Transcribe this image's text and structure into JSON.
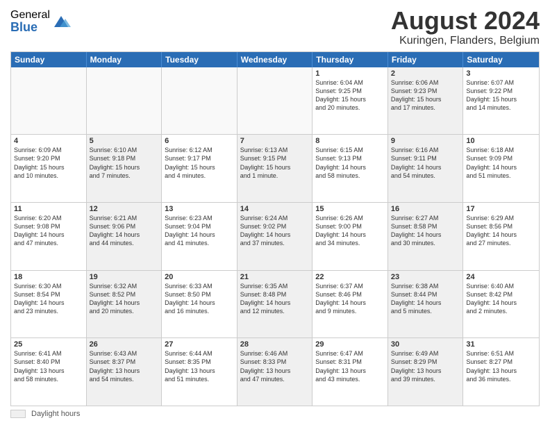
{
  "logo": {
    "general": "General",
    "blue": "Blue"
  },
  "title": "August 2024",
  "subtitle": "Kuringen, Flanders, Belgium",
  "days": [
    "Sunday",
    "Monday",
    "Tuesday",
    "Wednesday",
    "Thursday",
    "Friday",
    "Saturday"
  ],
  "rows": [
    [
      {
        "num": "",
        "info": "",
        "empty": true
      },
      {
        "num": "",
        "info": "",
        "empty": true
      },
      {
        "num": "",
        "info": "",
        "empty": true
      },
      {
        "num": "",
        "info": "",
        "empty": true
      },
      {
        "num": "1",
        "info": "Sunrise: 6:04 AM\nSunset: 9:25 PM\nDaylight: 15 hours\nand 20 minutes."
      },
      {
        "num": "2",
        "info": "Sunrise: 6:06 AM\nSunset: 9:23 PM\nDaylight: 15 hours\nand 17 minutes.",
        "shaded": true
      },
      {
        "num": "3",
        "info": "Sunrise: 6:07 AM\nSunset: 9:22 PM\nDaylight: 15 hours\nand 14 minutes."
      }
    ],
    [
      {
        "num": "4",
        "info": "Sunrise: 6:09 AM\nSunset: 9:20 PM\nDaylight: 15 hours\nand 10 minutes."
      },
      {
        "num": "5",
        "info": "Sunrise: 6:10 AM\nSunset: 9:18 PM\nDaylight: 15 hours\nand 7 minutes.",
        "shaded": true
      },
      {
        "num": "6",
        "info": "Sunrise: 6:12 AM\nSunset: 9:17 PM\nDaylight: 15 hours\nand 4 minutes."
      },
      {
        "num": "7",
        "info": "Sunrise: 6:13 AM\nSunset: 9:15 PM\nDaylight: 15 hours\nand 1 minute.",
        "shaded": true
      },
      {
        "num": "8",
        "info": "Sunrise: 6:15 AM\nSunset: 9:13 PM\nDaylight: 14 hours\nand 58 minutes."
      },
      {
        "num": "9",
        "info": "Sunrise: 6:16 AM\nSunset: 9:11 PM\nDaylight: 14 hours\nand 54 minutes.",
        "shaded": true
      },
      {
        "num": "10",
        "info": "Sunrise: 6:18 AM\nSunset: 9:09 PM\nDaylight: 14 hours\nand 51 minutes."
      }
    ],
    [
      {
        "num": "11",
        "info": "Sunrise: 6:20 AM\nSunset: 9:08 PM\nDaylight: 14 hours\nand 47 minutes."
      },
      {
        "num": "12",
        "info": "Sunrise: 6:21 AM\nSunset: 9:06 PM\nDaylight: 14 hours\nand 44 minutes.",
        "shaded": true
      },
      {
        "num": "13",
        "info": "Sunrise: 6:23 AM\nSunset: 9:04 PM\nDaylight: 14 hours\nand 41 minutes."
      },
      {
        "num": "14",
        "info": "Sunrise: 6:24 AM\nSunset: 9:02 PM\nDaylight: 14 hours\nand 37 minutes.",
        "shaded": true
      },
      {
        "num": "15",
        "info": "Sunrise: 6:26 AM\nSunset: 9:00 PM\nDaylight: 14 hours\nand 34 minutes."
      },
      {
        "num": "16",
        "info": "Sunrise: 6:27 AM\nSunset: 8:58 PM\nDaylight: 14 hours\nand 30 minutes.",
        "shaded": true
      },
      {
        "num": "17",
        "info": "Sunrise: 6:29 AM\nSunset: 8:56 PM\nDaylight: 14 hours\nand 27 minutes."
      }
    ],
    [
      {
        "num": "18",
        "info": "Sunrise: 6:30 AM\nSunset: 8:54 PM\nDaylight: 14 hours\nand 23 minutes."
      },
      {
        "num": "19",
        "info": "Sunrise: 6:32 AM\nSunset: 8:52 PM\nDaylight: 14 hours\nand 20 minutes.",
        "shaded": true
      },
      {
        "num": "20",
        "info": "Sunrise: 6:33 AM\nSunset: 8:50 PM\nDaylight: 14 hours\nand 16 minutes."
      },
      {
        "num": "21",
        "info": "Sunrise: 6:35 AM\nSunset: 8:48 PM\nDaylight: 14 hours\nand 12 minutes.",
        "shaded": true
      },
      {
        "num": "22",
        "info": "Sunrise: 6:37 AM\nSunset: 8:46 PM\nDaylight: 14 hours\nand 9 minutes."
      },
      {
        "num": "23",
        "info": "Sunrise: 6:38 AM\nSunset: 8:44 PM\nDaylight: 14 hours\nand 5 minutes.",
        "shaded": true
      },
      {
        "num": "24",
        "info": "Sunrise: 6:40 AM\nSunset: 8:42 PM\nDaylight: 14 hours\nand 2 minutes."
      }
    ],
    [
      {
        "num": "25",
        "info": "Sunrise: 6:41 AM\nSunset: 8:40 PM\nDaylight: 13 hours\nand 58 minutes."
      },
      {
        "num": "26",
        "info": "Sunrise: 6:43 AM\nSunset: 8:37 PM\nDaylight: 13 hours\nand 54 minutes.",
        "shaded": true
      },
      {
        "num": "27",
        "info": "Sunrise: 6:44 AM\nSunset: 8:35 PM\nDaylight: 13 hours\nand 51 minutes."
      },
      {
        "num": "28",
        "info": "Sunrise: 6:46 AM\nSunset: 8:33 PM\nDaylight: 13 hours\nand 47 minutes.",
        "shaded": true
      },
      {
        "num": "29",
        "info": "Sunrise: 6:47 AM\nSunset: 8:31 PM\nDaylight: 13 hours\nand 43 minutes."
      },
      {
        "num": "30",
        "info": "Sunrise: 6:49 AM\nSunset: 8:29 PM\nDaylight: 13 hours\nand 39 minutes.",
        "shaded": true
      },
      {
        "num": "31",
        "info": "Sunrise: 6:51 AM\nSunset: 8:27 PM\nDaylight: 13 hours\nand 36 minutes."
      }
    ]
  ],
  "footer": {
    "legend_label": "Daylight hours"
  }
}
